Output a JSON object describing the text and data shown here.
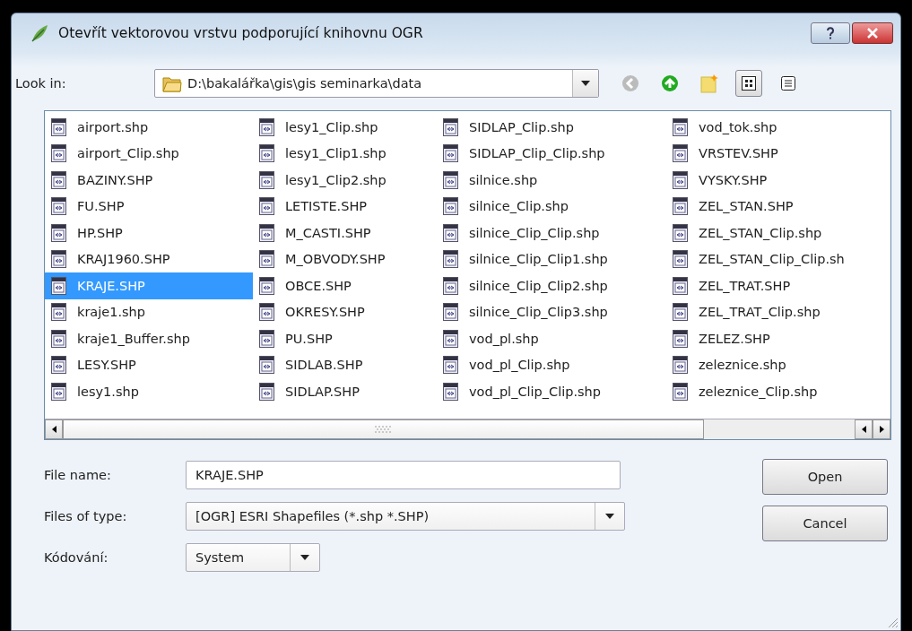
{
  "window": {
    "title": "Otevřít vektorovou vrstvu podporující knihovnu OGR"
  },
  "look_in": {
    "label": "Look in:",
    "path": "D:\\bakalářka\\gis\\gis seminarka\\data"
  },
  "files": [
    {
      "name": "airport.shp",
      "selected": false
    },
    {
      "name": "airport_Clip.shp",
      "selected": false
    },
    {
      "name": "BAZINY.SHP",
      "selected": false
    },
    {
      "name": "FU.SHP",
      "selected": false
    },
    {
      "name": "HP.SHP",
      "selected": false
    },
    {
      "name": "KRAJ1960.SHP",
      "selected": false
    },
    {
      "name": "KRAJE.SHP",
      "selected": true
    },
    {
      "name": "kraje1.shp",
      "selected": false
    },
    {
      "name": "kraje1_Buffer.shp",
      "selected": false
    },
    {
      "name": "LESY.SHP",
      "selected": false
    },
    {
      "name": "lesy1.shp",
      "selected": false
    },
    {
      "name": "lesy1_Clip.shp",
      "selected": false
    },
    {
      "name": "lesy1_Clip1.shp",
      "selected": false
    },
    {
      "name": "lesy1_Clip2.shp",
      "selected": false
    },
    {
      "name": "LETISTE.SHP",
      "selected": false
    },
    {
      "name": "M_CASTI.SHP",
      "selected": false
    },
    {
      "name": "M_OBVODY.SHP",
      "selected": false
    },
    {
      "name": "OBCE.SHP",
      "selected": false
    },
    {
      "name": "OKRESY.SHP",
      "selected": false
    },
    {
      "name": "PU.SHP",
      "selected": false
    },
    {
      "name": "SIDLAB.SHP",
      "selected": false
    },
    {
      "name": "SIDLAP.SHP",
      "selected": false
    },
    {
      "name": "SIDLAP_Clip.shp",
      "selected": false
    },
    {
      "name": "SIDLAP_Clip_Clip.shp",
      "selected": false
    },
    {
      "name": "silnice.shp",
      "selected": false
    },
    {
      "name": "silnice_Clip.shp",
      "selected": false
    },
    {
      "name": "silnice_Clip_Clip.shp",
      "selected": false
    },
    {
      "name": "silnice_Clip_Clip1.shp",
      "selected": false
    },
    {
      "name": "silnice_Clip_Clip2.shp",
      "selected": false
    },
    {
      "name": "silnice_Clip_Clip3.shp",
      "selected": false
    },
    {
      "name": "vod_pl.shp",
      "selected": false
    },
    {
      "name": "vod_pl_Clip.shp",
      "selected": false
    },
    {
      "name": "vod_pl_Clip_Clip.shp",
      "selected": false
    },
    {
      "name": "vod_tok.shp",
      "selected": false
    },
    {
      "name": "VRSTEV.SHP",
      "selected": false
    },
    {
      "name": "VYSKY.SHP",
      "selected": false
    },
    {
      "name": "ZEL_STAN.SHP",
      "selected": false
    },
    {
      "name": "ZEL_STAN_Clip.shp",
      "selected": false
    },
    {
      "name": "ZEL_STAN_Clip_Clip.sh",
      "selected": false
    },
    {
      "name": "ZEL_TRAT.SHP",
      "selected": false
    },
    {
      "name": "ZEL_TRAT_Clip.shp",
      "selected": false
    },
    {
      "name": "ZELEZ.SHP",
      "selected": false
    },
    {
      "name": "zeleznice.shp",
      "selected": false
    },
    {
      "name": "zeleznice_Clip.shp",
      "selected": false
    }
  ],
  "file_name": {
    "label": "File name:",
    "value": "KRAJE.SHP"
  },
  "file_type": {
    "label": "Files of type:",
    "value": "[OGR] ESRI Shapefiles (*.shp *.SHP)"
  },
  "encoding": {
    "label": "Kódování:",
    "value": "System"
  },
  "buttons": [
    "Open",
    "Cancel"
  ]
}
